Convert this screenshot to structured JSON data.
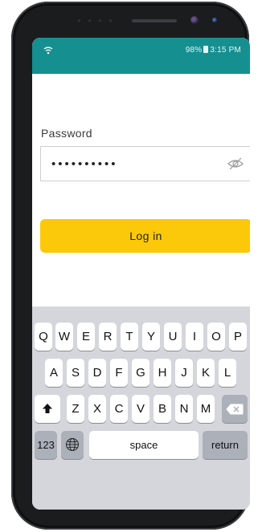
{
  "status_bar": {
    "left_icon": "wifi-call-icon",
    "right_text": "98%",
    "battery_icon": "battery-icon",
    "time": "3:15 PM"
  },
  "form": {
    "password_label": "Password",
    "password_value": "••••••••••",
    "visibility_icon": "eye-slash-icon",
    "login_label": "Log in"
  },
  "keyboard": {
    "row1": [
      "Q",
      "W",
      "E",
      "R",
      "T",
      "Y",
      "U",
      "I",
      "O",
      "P"
    ],
    "row2": [
      "A",
      "S",
      "D",
      "F",
      "G",
      "H",
      "J",
      "K",
      "L"
    ],
    "row3": [
      "Z",
      "X",
      "C",
      "V",
      "B",
      "N",
      "M"
    ],
    "numbers_label": "123",
    "space_label": "space",
    "return_label": "return",
    "shift_icon": "shift-icon",
    "globe_icon": "globe-icon",
    "delete_icon": "backspace-icon"
  },
  "colors": {
    "status_bar": "#158f8f",
    "login_button": "#fcc80a",
    "keyboard_bg": "#d4d6dc"
  }
}
